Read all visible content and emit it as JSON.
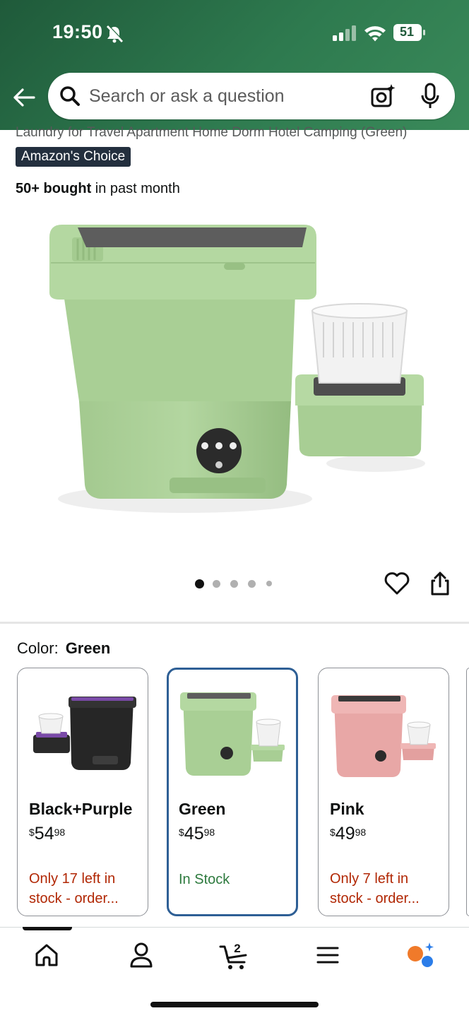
{
  "status": {
    "time": "19:50",
    "battery": "51"
  },
  "header": {
    "search_placeholder": "Search or ask a question",
    "icons": [
      "back-arrow-icon",
      "search-icon",
      "camera-icon",
      "microphone-icon"
    ]
  },
  "product": {
    "title_fragment": "Laundry for Travel Apartment Home Dorm Hotel Camping (Green)",
    "badge": "Amazon's Choice",
    "bought_bold": "50+ bought",
    "bought_rest": " in past month",
    "image_pager": {
      "count": 5,
      "active": 1
    }
  },
  "color_selector": {
    "label": "Color:",
    "selected": "Green",
    "options": [
      {
        "name": "Black+Purple",
        "currency": "$",
        "price_whole": "54",
        "price_fraction": "98",
        "stock": "Only 17 left in stock - order...",
        "stock_status": "low",
        "body_color": "#2a2a2a",
        "accent_color": "#7a4aa8",
        "selected": false
      },
      {
        "name": "Green",
        "currency": "$",
        "price_whole": "45",
        "price_fraction": "98",
        "stock": "In Stock",
        "stock_status": "in",
        "body_color": "#a9cf98",
        "accent_color": "#8fbe7e",
        "selected": true
      },
      {
        "name": "Pink",
        "currency": "$",
        "price_whole": "49",
        "price_fraction": "98",
        "stock": "Only 7 left in stock - order...",
        "stock_status": "low",
        "body_color": "#e8a7a6",
        "accent_color": "#d98f8e",
        "selected": false
      }
    ]
  },
  "bottom_nav": {
    "items": [
      "home-icon",
      "account-icon",
      "cart-icon",
      "menu-icon",
      "rufus-ai-icon"
    ],
    "cart_count": "2"
  },
  "colors": {
    "header_green": "#2e7a4f",
    "badge_bg": "#232f3e",
    "low_stock_red": "#b12704",
    "in_stock_green": "#2d7a3e",
    "selected_border": "#2e5f95"
  }
}
